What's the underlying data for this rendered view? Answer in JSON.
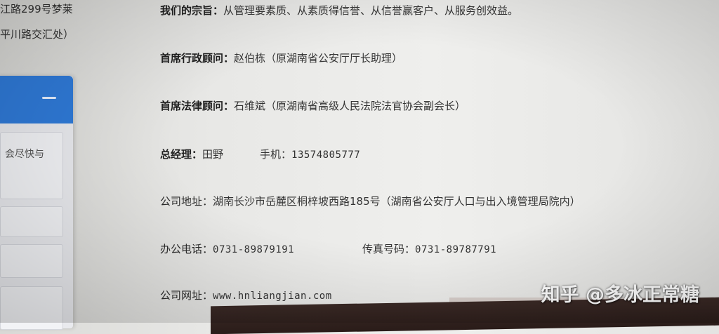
{
  "left_fragment": {
    "line1": "江路299号梦莱",
    "line2": "平川路交汇处）"
  },
  "side_panel": {
    "preview_text": "会尽快与"
  },
  "company_info": {
    "mission": {
      "label": "我们的宗旨：",
      "value": "从管理要素质、从素质得信誉、从信誉赢客户、从服务创效益。"
    },
    "admin_advisor": {
      "label": "首席行政顾问：",
      "value": "赵伯栋（原湖南省公安厅厅长助理）"
    },
    "legal_advisor": {
      "label": "首席法律顾问：",
      "value": "石维斌（原湖南省高级人民法院法官协会副会长）"
    },
    "general_manager": {
      "label": "总经理：",
      "value": "田野"
    },
    "mobile": {
      "label": "手机：",
      "value": "13574805777"
    },
    "address": {
      "label": "公司地址：",
      "value": "湖南长沙市岳麓区桐梓坡西路185号（湖南省公安厅人口与出入境管理局院内）"
    },
    "office_phone": {
      "label": "办公电话：",
      "value": "0731-89879191"
    },
    "fax": {
      "label": "传真号码：",
      "value": "0731-89787791"
    },
    "website": {
      "label": "公司网址：",
      "value": "www.hnliangjian.com"
    }
  },
  "watermark": "知乎 @多冰正常糖"
}
